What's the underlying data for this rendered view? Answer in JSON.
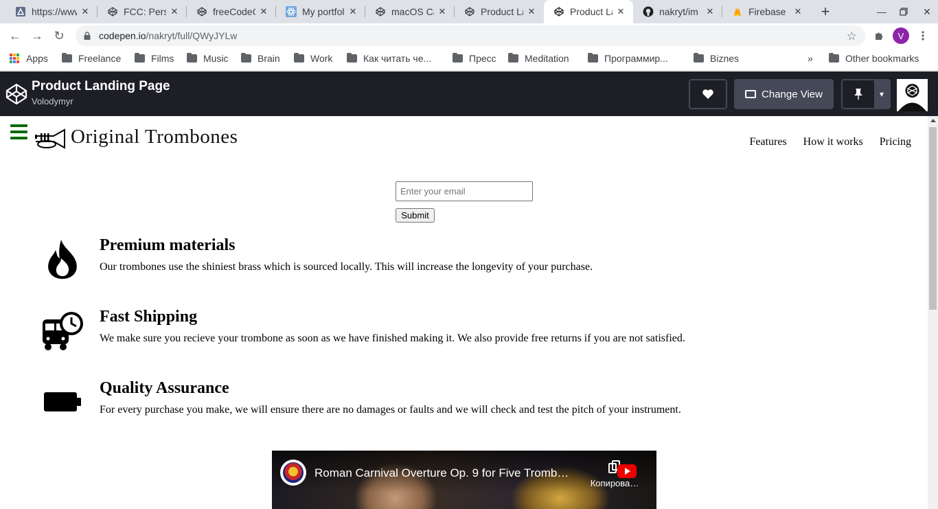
{
  "browser": {
    "tabs": [
      {
        "title": "https://www.",
        "icon": "triangle-logo-icon"
      },
      {
        "title": "FCC: Personal",
        "icon": "codepen-icon"
      },
      {
        "title": "freeCodeCamp",
        "icon": "codepen-icon"
      },
      {
        "title": "My portfolio",
        "icon": "react-icon"
      },
      {
        "title": "macOS Calc",
        "icon": "codepen-icon"
      },
      {
        "title": "Product Landing",
        "icon": "codepen-icon"
      },
      {
        "title": "Product Landing",
        "icon": "codepen-icon"
      },
      {
        "title": "nakryt/im",
        "icon": "github-icon"
      },
      {
        "title": "Firebase",
        "icon": "firebase-icon"
      }
    ],
    "active_tab_index": 6,
    "url_host": "codepen.io",
    "url_path": "/nakryt/full/QWyJYLw",
    "profile_initial": "V",
    "bookmarks": [
      {
        "label": "Apps"
      },
      {
        "label": "Freelance"
      },
      {
        "label": "Films"
      },
      {
        "label": "Music"
      },
      {
        "label": "Brain"
      },
      {
        "label": "Work"
      },
      {
        "label": "Как читать че..."
      },
      {
        "label": "Пресс"
      },
      {
        "label": "Meditation"
      },
      {
        "label": "Программир..."
      },
      {
        "label": "Biznes"
      }
    ],
    "bookmarks_overflow": "»",
    "other_bookmarks": "Other bookmarks"
  },
  "codepen": {
    "title": "Product Landing Page",
    "author": "Volodymyr",
    "change_view_label": "Change View"
  },
  "site": {
    "brand": "Original Trombones",
    "nav": [
      "Features",
      "How it works",
      "Pricing"
    ],
    "email_placeholder": "Enter your email",
    "submit_label": "Submit",
    "features": [
      {
        "title": "Premium materials",
        "text": "Our trombones use the shiniest brass which is sourced locally. This will increase the longevity of your purchase.",
        "icon": "fire-icon"
      },
      {
        "title": "Fast Shipping",
        "text": "We make sure you recieve your trombone as soon as we have finished making it. We also provide free returns if you are not satisfied.",
        "icon": "shuttle-van-clock-icon"
      },
      {
        "title": "Quality Assurance",
        "text": "For every purchase you make, we will ensure there are no damages or faults and we will check and test the pitch of your instrument.",
        "icon": "battery-full-icon"
      }
    ],
    "video": {
      "title": "Roman Carnival Overture Op. 9 for Five Tromb…",
      "copy_label": "Копирова…"
    }
  },
  "colors": {
    "tabstrip_bg": "#dee1e6",
    "codepen_header_bg": "#1e1f26",
    "codepen_button_bg": "#444857",
    "hamburger": "#0a6a0a"
  }
}
